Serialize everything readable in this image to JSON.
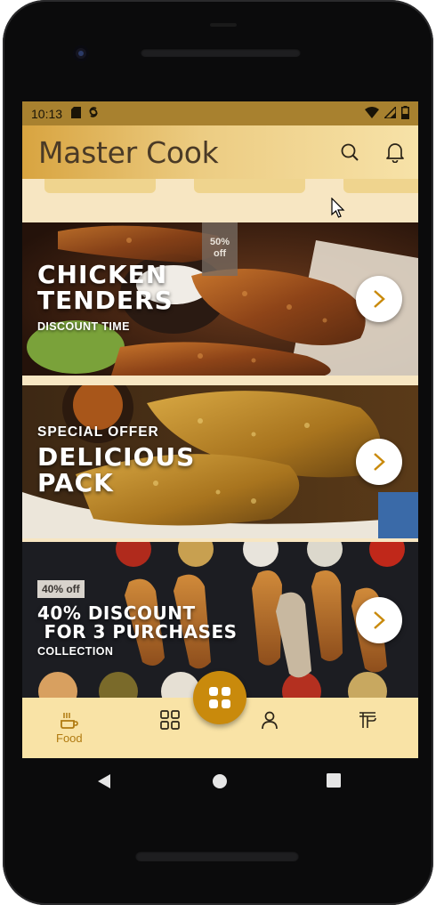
{
  "status_bar": {
    "time": "10:13",
    "icons": [
      "sd-card-icon",
      "sync-icon",
      "wifi-icon",
      "signal-icon",
      "battery-icon"
    ]
  },
  "app_bar": {
    "title": "Master Cook",
    "actions": [
      "search-icon",
      "bell-icon"
    ]
  },
  "banners": [
    {
      "title_lines": [
        "CHICKEN",
        "TENDERS"
      ],
      "subtitle": "DISCOUNT TIME",
      "tag_line1": "50%",
      "tag_line2": "off"
    },
    {
      "overline": "SPECIAL OFFER",
      "title_lines": [
        "DELICIOUS",
        "PACK"
      ]
    },
    {
      "tag": "40% off",
      "title_lines": [
        "40% DISCOUNT",
        " FOR 3 PURCHASES"
      ],
      "subtitle": "COLLECTION"
    }
  ],
  "bottom_nav": {
    "items": [
      {
        "icon": "food-icon",
        "label": "Food"
      },
      {
        "icon": "grid-icon"
      },
      {
        "icon": "profile-icon"
      },
      {
        "icon": "brand-icon"
      }
    ],
    "fab_icon": "apps-icon"
  },
  "colors": {
    "accent": "#c98a0c",
    "nav_background": "#f9e3a6",
    "app_bar_text": "#4a3a26",
    "status_bar": "#a8812f"
  }
}
